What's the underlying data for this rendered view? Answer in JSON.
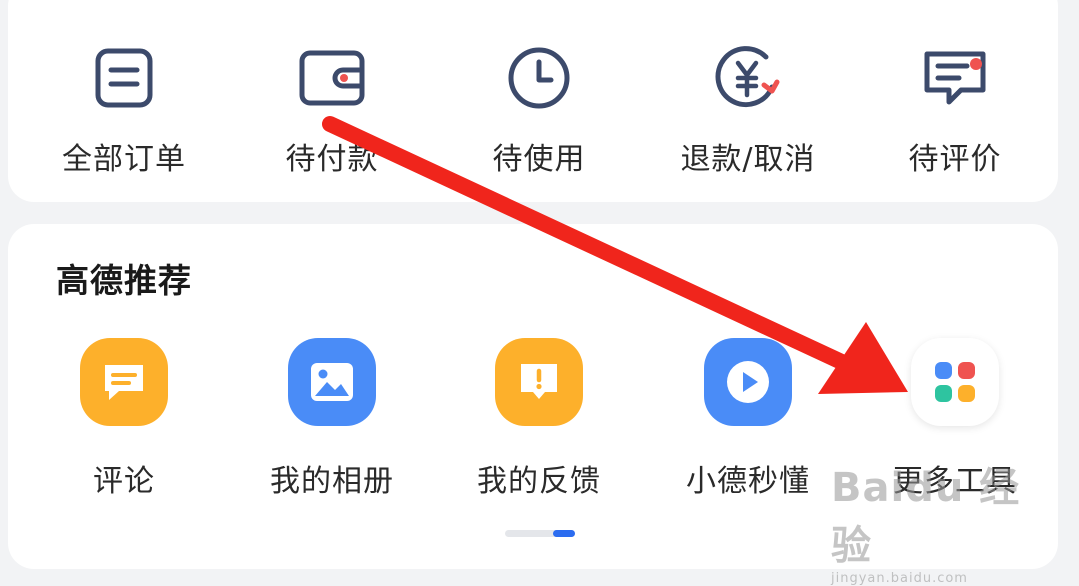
{
  "orders": {
    "items": [
      {
        "label": "全部订单",
        "icon": "order-list-icon"
      },
      {
        "label": "待付款",
        "icon": "wallet-icon"
      },
      {
        "label": "待使用",
        "icon": "clock-icon"
      },
      {
        "label": "退款/取消",
        "icon": "refund-yen-icon"
      },
      {
        "label": "待评价",
        "icon": "review-message-icon"
      }
    ]
  },
  "recommend": {
    "title": "高德推荐",
    "items": [
      {
        "label": "评论",
        "icon": "comment-icon"
      },
      {
        "label": "我的相册",
        "icon": "album-icon"
      },
      {
        "label": "我的反馈",
        "icon": "feedback-icon"
      },
      {
        "label": "小德秒懂",
        "icon": "play-icon"
      },
      {
        "label": "更多工具",
        "icon": "more-tools-icon"
      }
    ]
  },
  "colors": {
    "icon_stroke": "#3c4a6b",
    "accent_red": "#ef5350",
    "comment_orange": "#fdb02b",
    "album_blue": "#4a8cf7",
    "feedback_orange": "#fdb02b",
    "play_blue": "#4a8cf7",
    "arrow_red": "#f0251c",
    "pager_active": "#2b6cf0"
  },
  "watermark": {
    "brand": "Baidu 经验",
    "url": "jingyan.baidu.com"
  }
}
